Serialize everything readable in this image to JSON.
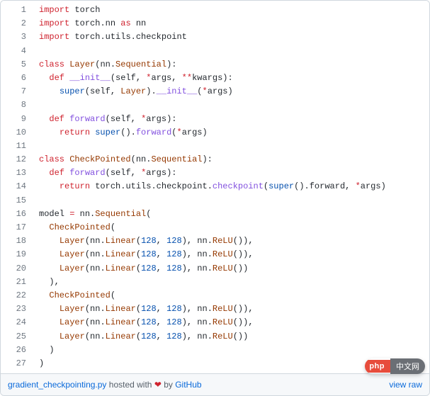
{
  "lines": [
    {
      "n": "1",
      "html": "<span class='k'>import</span> <span class='nm'>torch</span>"
    },
    {
      "n": "2",
      "html": "<span class='k'>import</span> <span class='nm'>torch</span><span class='pn'>.</span><span class='nm'>nn</span> <span class='k'>as</span> <span class='nm'>nn</span>"
    },
    {
      "n": "3",
      "html": "<span class='k'>import</span> <span class='nm'>torch</span><span class='pn'>.</span><span class='nm'>utils</span><span class='pn'>.</span><span class='nm'>checkpoint</span>"
    },
    {
      "n": "4",
      "html": ""
    },
    {
      "n": "5",
      "html": "<span class='k'>class</span> <span class='cls'>Layer</span><span class='pn'>(</span><span class='nm'>nn</span><span class='pn'>.</span><span class='cls'>Sequential</span><span class='pn'>):</span>"
    },
    {
      "n": "6",
      "html": "  <span class='k'>def</span> <span class='fn'>__init__</span><span class='pn'>(</span><span class='self'>self</span><span class='pn'>, </span><span class='op'>*</span><span class='nm'>args</span><span class='pn'>, </span><span class='op'>**</span><span class='nm'>kwargs</span><span class='pn'>):</span>"
    },
    {
      "n": "7",
      "html": "    <span class='bi'>super</span><span class='pn'>(</span><span class='self'>self</span><span class='pn'>, </span><span class='cls'>Layer</span><span class='pn'>).</span><span class='fn'>__init__</span><span class='pn'>(</span><span class='op'>*</span><span class='nm'>args</span><span class='pn'>)</span>"
    },
    {
      "n": "8",
      "html": ""
    },
    {
      "n": "9",
      "html": "  <span class='k'>def</span> <span class='fn'>forward</span><span class='pn'>(</span><span class='self'>self</span><span class='pn'>, </span><span class='op'>*</span><span class='nm'>args</span><span class='pn'>):</span>"
    },
    {
      "n": "10",
      "html": "    <span class='k'>return</span> <span class='bi'>super</span><span class='pn'>().</span><span class='fn'>forward</span><span class='pn'>(</span><span class='op'>*</span><span class='nm'>args</span><span class='pn'>)</span>"
    },
    {
      "n": "11",
      "html": ""
    },
    {
      "n": "12",
      "html": "<span class='k'>class</span> <span class='cls'>CheckPointed</span><span class='pn'>(</span><span class='nm'>nn</span><span class='pn'>.</span><span class='cls'>Sequential</span><span class='pn'>):</span>"
    },
    {
      "n": "13",
      "html": "  <span class='k'>def</span> <span class='fn'>forward</span><span class='pn'>(</span><span class='self'>self</span><span class='pn'>, </span><span class='op'>*</span><span class='nm'>args</span><span class='pn'>):</span>"
    },
    {
      "n": "14",
      "html": "    <span class='k'>return</span> <span class='nm'>torch</span><span class='pn'>.</span><span class='nm'>utils</span><span class='pn'>.</span><span class='nm'>checkpoint</span><span class='pn'>.</span><span class='fn'>checkpoint</span><span class='pn'>(</span><span class='bi'>super</span><span class='pn'>().</span><span class='nm'>forward</span><span class='pn'>, </span><span class='op'>*</span><span class='nm'>args</span><span class='pn'>)</span>"
    },
    {
      "n": "15",
      "html": ""
    },
    {
      "n": "16",
      "html": "<span class='nm'>model</span> <span class='op'>=</span> <span class='nm'>nn</span><span class='pn'>.</span><span class='cls'>Sequential</span><span class='pn'>(</span>"
    },
    {
      "n": "17",
      "html": "  <span class='cls'>CheckPointed</span><span class='pn'>(</span>"
    },
    {
      "n": "18",
      "html": "    <span class='cls'>Layer</span><span class='pn'>(</span><span class='nm'>nn</span><span class='pn'>.</span><span class='cls'>Linear</span><span class='pn'>(</span><span class='num'>128</span><span class='pn'>, </span><span class='num'>128</span><span class='pn'>), </span><span class='nm'>nn</span><span class='pn'>.</span><span class='cls'>ReLU</span><span class='pn'>()),</span>"
    },
    {
      "n": "19",
      "html": "    <span class='cls'>Layer</span><span class='pn'>(</span><span class='nm'>nn</span><span class='pn'>.</span><span class='cls'>Linear</span><span class='pn'>(</span><span class='num'>128</span><span class='pn'>, </span><span class='num'>128</span><span class='pn'>), </span><span class='nm'>nn</span><span class='pn'>.</span><span class='cls'>ReLU</span><span class='pn'>()),</span>"
    },
    {
      "n": "20",
      "html": "    <span class='cls'>Layer</span><span class='pn'>(</span><span class='nm'>nn</span><span class='pn'>.</span><span class='cls'>Linear</span><span class='pn'>(</span><span class='num'>128</span><span class='pn'>, </span><span class='num'>128</span><span class='pn'>), </span><span class='nm'>nn</span><span class='pn'>.</span><span class='cls'>ReLU</span><span class='pn'>())</span>"
    },
    {
      "n": "21",
      "html": "  <span class='pn'>),</span>"
    },
    {
      "n": "22",
      "html": "  <span class='cls'>CheckPointed</span><span class='pn'>(</span>"
    },
    {
      "n": "23",
      "html": "    <span class='cls'>Layer</span><span class='pn'>(</span><span class='nm'>nn</span><span class='pn'>.</span><span class='cls'>Linear</span><span class='pn'>(</span><span class='num'>128</span><span class='pn'>, </span><span class='num'>128</span><span class='pn'>), </span><span class='nm'>nn</span><span class='pn'>.</span><span class='cls'>ReLU</span><span class='pn'>()),</span>"
    },
    {
      "n": "24",
      "html": "    <span class='cls'>Layer</span><span class='pn'>(</span><span class='nm'>nn</span><span class='pn'>.</span><span class='cls'>Linear</span><span class='pn'>(</span><span class='num'>128</span><span class='pn'>, </span><span class='num'>128</span><span class='pn'>), </span><span class='nm'>nn</span><span class='pn'>.</span><span class='cls'>ReLU</span><span class='pn'>()),</span>"
    },
    {
      "n": "25",
      "html": "    <span class='cls'>Layer</span><span class='pn'>(</span><span class='nm'>nn</span><span class='pn'>.</span><span class='cls'>Linear</span><span class='pn'>(</span><span class='num'>128</span><span class='pn'>, </span><span class='num'>128</span><span class='pn'>), </span><span class='nm'>nn</span><span class='pn'>.</span><span class='cls'>ReLU</span><span class='pn'>())</span>"
    },
    {
      "n": "26",
      "html": "  <span class='pn'>)</span>"
    },
    {
      "n": "27",
      "html": "<span class='pn'>)</span>"
    }
  ],
  "meta": {
    "filename": "gradient_checkpointing.py",
    "hosted_text": " hosted with ",
    "by_text": " by ",
    "github": "GitHub",
    "view_raw": "view raw",
    "heart": "❤"
  },
  "badge": {
    "left": "php",
    "right": "中文网"
  }
}
